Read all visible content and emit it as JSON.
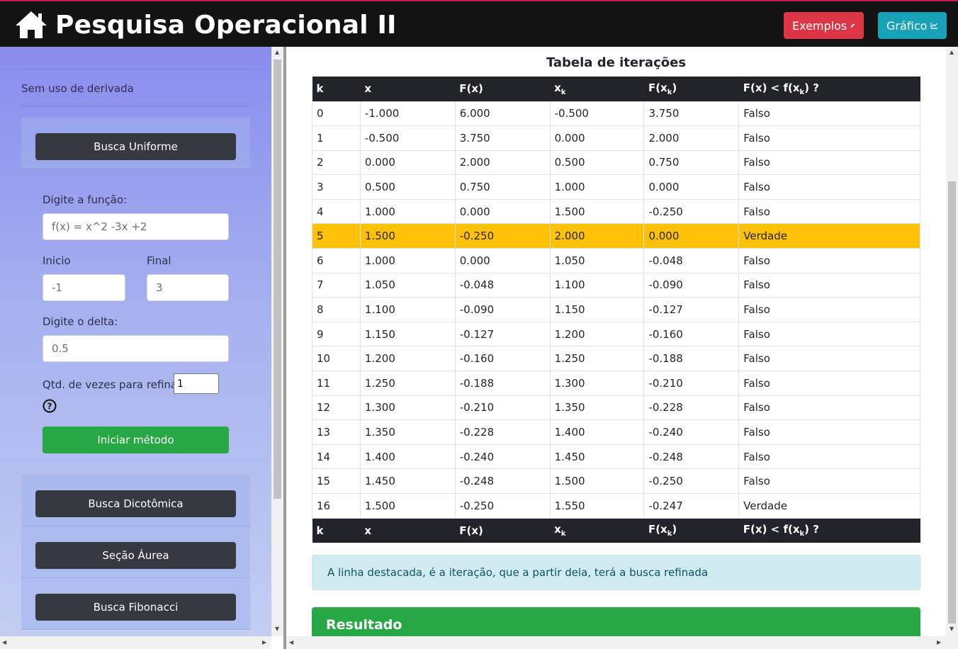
{
  "navbar": {
    "title": "Pesquisa Operacional II",
    "examples_label": "Exemplos",
    "chart_label": "Gráfico",
    "icons": {
      "home": "home-icon",
      "pencil": "pencil-icon",
      "chart": "line-chart-icon"
    }
  },
  "sidebar": {
    "section_label": "Sem uso de derivada",
    "methods": {
      "uniforme": "Busca Uniforme",
      "dicotomica": "Busca Dicotômica",
      "aurea": "Seção Áurea",
      "fibonacci": "Busca Fibonacci"
    },
    "form": {
      "function_label": "Digite a função:",
      "function_value": "f(x) = x^2 -3x +2",
      "start_label": "Inicio",
      "start_value": "-1",
      "end_label": "Final",
      "end_value": "3",
      "delta_label": "Digite o delta:",
      "delta_value": "0.5",
      "refine_label": "Qtd. de vezes para refinar",
      "refine_value": "1",
      "start_button": "Iniciar método"
    }
  },
  "main": {
    "table_title": "Tabela de iterações",
    "headers": {
      "k": "k",
      "x": "x",
      "fx": "F(x)",
      "xk_base": "x",
      "xk_sub": "k",
      "fxk_base": "F(x",
      "fxk_sub": "k",
      "fxk_end": ")",
      "cmp_base": "F(x) < f(x",
      "cmp_sub": "k",
      "cmp_end": ") ?"
    },
    "rows": [
      [
        "0",
        "-1.000",
        "6.000",
        "-0.500",
        "3.750",
        "Falso"
      ],
      [
        "1",
        "-0.500",
        "3.750",
        "0.000",
        "2.000",
        "Falso"
      ],
      [
        "2",
        "0.000",
        "2.000",
        "0.500",
        "0.750",
        "Falso"
      ],
      [
        "3",
        "0.500",
        "0.750",
        "1.000",
        "0.000",
        "Falso"
      ],
      [
        "4",
        "1.000",
        "0.000",
        "1.500",
        "-0.250",
        "Falso"
      ],
      [
        "5",
        "1.500",
        "-0.250",
        "2.000",
        "0.000",
        "Verdade"
      ],
      [
        "6",
        "1.000",
        "0.000",
        "1.050",
        "-0.048",
        "Falso"
      ],
      [
        "7",
        "1.050",
        "-0.048",
        "1.100",
        "-0.090",
        "Falso"
      ],
      [
        "8",
        "1.100",
        "-0.090",
        "1.150",
        "-0.127",
        "Falso"
      ],
      [
        "9",
        "1.150",
        "-0.127",
        "1.200",
        "-0.160",
        "Falso"
      ],
      [
        "10",
        "1.200",
        "-0.160",
        "1.250",
        "-0.188",
        "Falso"
      ],
      [
        "11",
        "1.250",
        "-0.188",
        "1.300",
        "-0.210",
        "Falso"
      ],
      [
        "12",
        "1.300",
        "-0.210",
        "1.350",
        "-0.228",
        "Falso"
      ],
      [
        "13",
        "1.350",
        "-0.228",
        "1.400",
        "-0.240",
        "Falso"
      ],
      [
        "14",
        "1.400",
        "-0.240",
        "1.450",
        "-0.248",
        "Falso"
      ],
      [
        "15",
        "1.450",
        "-0.248",
        "1.500",
        "-0.250",
        "Falso"
      ],
      [
        "16",
        "1.500",
        "-0.250",
        "1.550",
        "-0.247",
        "Verdade"
      ]
    ],
    "highlight_row": 5,
    "highlight_color": "#ffc107",
    "alert_text": "A linha destacada, é a iteração, que a partir dela, terá a busca refinada",
    "result_title": "Resultado"
  }
}
